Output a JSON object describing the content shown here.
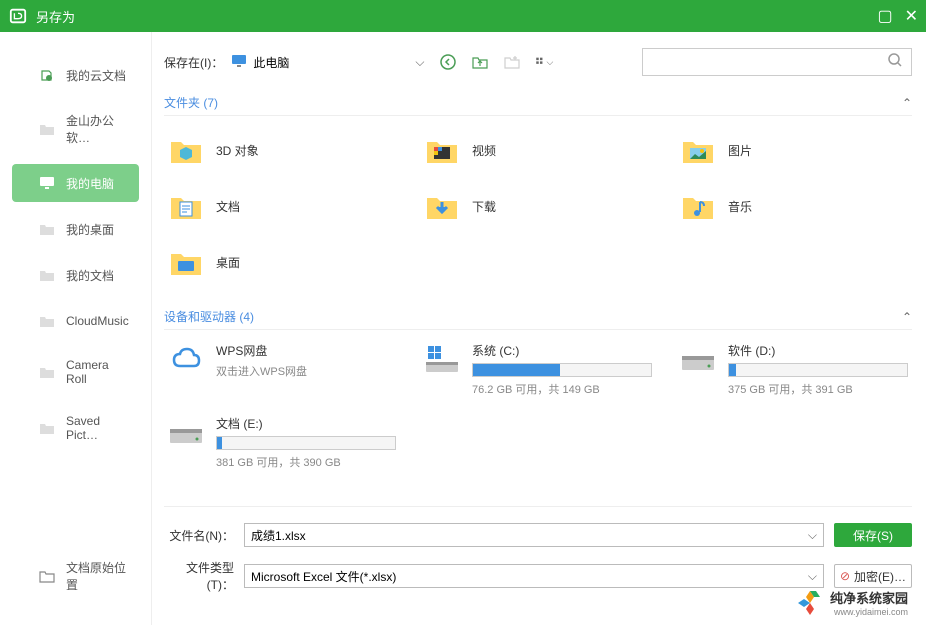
{
  "titlebar": {
    "title": "另存为"
  },
  "sidebar": {
    "items": [
      {
        "label": "我的云文档"
      },
      {
        "label": "金山办公软…"
      },
      {
        "label": "我的电脑"
      },
      {
        "label": "我的桌面"
      },
      {
        "label": "我的文档"
      },
      {
        "label": "CloudMusic"
      },
      {
        "label": "Camera Roll"
      },
      {
        "label": "Saved Pict…"
      }
    ],
    "bottom": {
      "label": "文档原始位置"
    }
  },
  "toolbar": {
    "location_label": "保存在(I)：",
    "location_value": "此电脑"
  },
  "search": {
    "placeholder": ""
  },
  "sections": {
    "folders": {
      "title": "文件夹 (7)"
    },
    "drives": {
      "title": "设备和驱动器 (4)"
    }
  },
  "folders": [
    {
      "label": "3D 对象"
    },
    {
      "label": "视频"
    },
    {
      "label": "图片"
    },
    {
      "label": "文档"
    },
    {
      "label": "下载"
    },
    {
      "label": "音乐"
    },
    {
      "label": "桌面"
    }
  ],
  "drives": [
    {
      "name": "WPS网盘",
      "sub": "双击进入WPS网盘",
      "type": "cloud"
    },
    {
      "name": "系统 (C:)",
      "free": "76.2 GB 可用，共 149 GB",
      "fill": 49,
      "type": "disk"
    },
    {
      "name": "软件 (D:)",
      "free": "375 GB 可用，共 391 GB",
      "fill": 4,
      "type": "disk"
    },
    {
      "name": "文档 (E:)",
      "free": "381 GB 可用，共 390 GB",
      "fill": 3,
      "type": "disk"
    }
  ],
  "form": {
    "filename_label": "文件名(N)：",
    "filename_value": "成绩1.xlsx",
    "filetype_label": "文件类型(T)：",
    "filetype_value": "Microsoft Excel 文件(*.xlsx)",
    "save_label": "保存(S)",
    "encrypt_label": "加密(E)…"
  },
  "watermark": {
    "main": "纯净系统家园",
    "sub": "www.yidaimei.com"
  }
}
